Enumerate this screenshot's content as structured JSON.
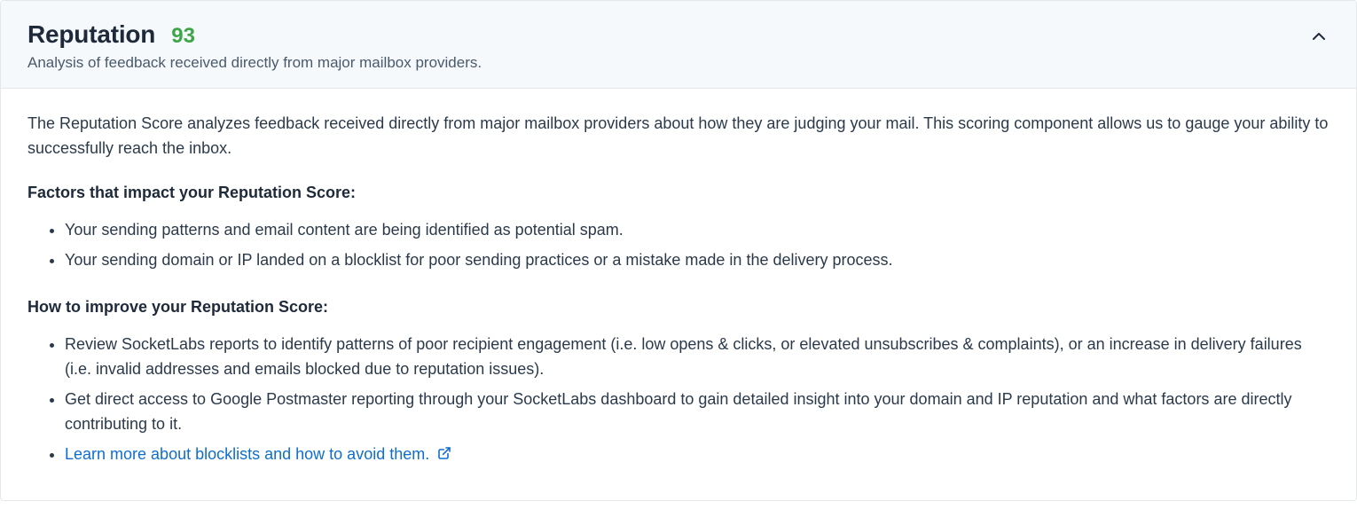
{
  "header": {
    "title": "Reputation",
    "score": "93",
    "subtitle": "Analysis of feedback received directly from major mailbox providers."
  },
  "body": {
    "intro": "The Reputation Score analyzes feedback received directly from major mailbox providers about how they are judging your mail. This scoring component allows us to gauge your ability to successfully reach the inbox.",
    "factors_heading": "Factors that impact your Reputation Score:",
    "factors": [
      "Your sending patterns and email content are being identified as potential spam.",
      "Your sending domain or IP landed on a blocklist for poor sending practices or a mistake made in the delivery process."
    ],
    "improve_heading": "How to improve your Reputation Score:",
    "improve": [
      "Review SocketLabs reports to identify patterns of poor recipient engagement (i.e. low opens & clicks, or elevated unsubscribes & complaints), or an increase in delivery failures (i.e. invalid addresses and emails blocked due to reputation issues).",
      "Get direct access to Google Postmaster reporting through your SocketLabs dashboard to gain detailed insight into your domain and IP reputation and what factors are directly contributing to it."
    ],
    "link_text": "Learn more about blocklists and how to avoid them."
  }
}
